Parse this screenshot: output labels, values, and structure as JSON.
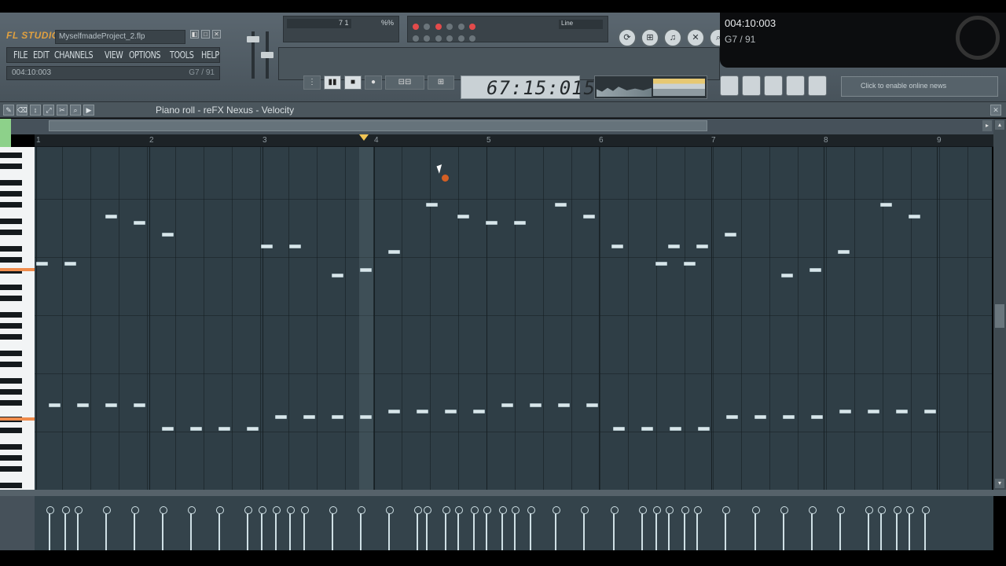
{
  "app": {
    "logo": "FL STUDIO",
    "project_file": "MyselfmadeProject_2.flp",
    "window_buttons": [
      "◧",
      "□",
      "✕"
    ]
  },
  "menu": [
    "FILE",
    "EDIT",
    "CHANNELS",
    "VIEW",
    "OPTIONS",
    "TOOLS",
    "HELP"
  ],
  "hint": {
    "position": "004:10:003",
    "note": "G7 / 91"
  },
  "panels": {
    "pattern_display": "7 1",
    "pattern_small": "%%",
    "snap_label": "Line"
  },
  "transport": {
    "buttons": [
      "▮▮",
      "■",
      "●"
    ],
    "time": "67:15:015"
  },
  "news": {
    "placeholder": "Click to enable online news"
  },
  "overlay": {
    "time": "004:10:003",
    "note": "G7 / 91"
  },
  "piano_roll": {
    "title": "Piano roll - reFX Nexus - Velocity",
    "ruler_ticks": [
      "1",
      "2",
      "3",
      "4",
      "5",
      "6",
      "7",
      "8",
      "9"
    ],
    "tools": [
      "✎",
      "⌫",
      "↕",
      "⤢",
      "✂",
      "⌕",
      "▶"
    ],
    "close": "✕"
  },
  "colors": {
    "grid_bg": "#2f3e46",
    "note": "#d9e6ea",
    "playhead": "#f0c454",
    "highlight_key": "#f08c4c"
  }
}
